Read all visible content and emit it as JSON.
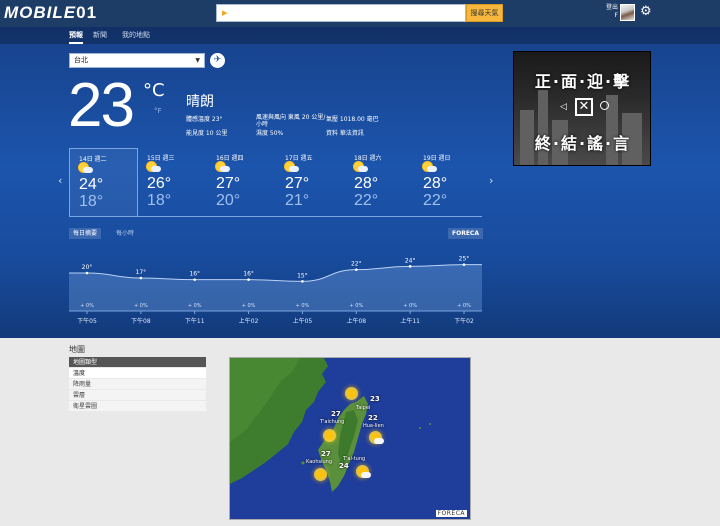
{
  "header": {
    "logo": {
      "a": "MOBILE",
      "b": "01"
    },
    "search": {
      "value": "",
      "button": "搜尋天氣"
    },
    "login": {
      "line1": "登出",
      "line2": "F"
    }
  },
  "nav": {
    "items": [
      "預報",
      "新聞",
      "我的地點"
    ]
  },
  "current": {
    "city": "台北",
    "temp": "23",
    "unit_c": "°C",
    "unit_f": "°F",
    "condition": "晴朗",
    "details": {
      "feels": "體感溫度 23°",
      "visibility": "能見度 10 公里",
      "wind": "風速與風向 東風 20 公里/",
      "wind2": "小時",
      "humidity": "濕度 50%",
      "pressure": "氣壓 1018.00 毫巴",
      "source": "資料 華法資訊"
    }
  },
  "forecast": [
    {
      "day": "14日 週二",
      "hi": "24°",
      "lo": "18°"
    },
    {
      "day": "15日 週三",
      "hi": "26°",
      "lo": "18°"
    },
    {
      "day": "16日 週四",
      "hi": "27°",
      "lo": "20°"
    },
    {
      "day": "17日 週五",
      "hi": "27°",
      "lo": "21°"
    },
    {
      "day": "18日 週六",
      "hi": "28°",
      "lo": "22°"
    },
    {
      "day": "19日 週日",
      "hi": "28°",
      "lo": "22°"
    }
  ],
  "chart_tabs": {
    "daily": "每日摘要",
    "hourly": "每小時",
    "provider": "FORECA"
  },
  "chart_data": {
    "type": "area",
    "categories": [
      "下午05",
      "下午08",
      "下午11",
      "上午02",
      "上午05",
      "上午08",
      "上午11",
      "下午02"
    ],
    "series": [
      {
        "values": [
          20,
          17,
          16,
          16,
          15,
          22,
          24,
          25
        ]
      }
    ],
    "temp_labels": [
      "20°",
      "17°",
      "16°",
      "16°",
      "15°",
      "22°",
      "24°",
      "25°"
    ],
    "precip_labels": [
      "+ 0%",
      "+ 0%",
      "+ 0%",
      "+ 0%",
      "+ 0%",
      "+ 0%",
      "+ 0%",
      "+ 0%"
    ],
    "ylim": [
      0,
      30
    ]
  },
  "ad": {
    "line1": "正·面·迎·擊",
    "line2": "終·結·謠·言"
  },
  "maps": {
    "title": "地圖",
    "list": [
      "地圖類型",
      "溫度",
      "降雨量",
      "雲層",
      "衛星雲圖"
    ],
    "foreca": "FORECA",
    "cities": [
      {
        "name": "Taipei",
        "temp": "23"
      },
      {
        "name": "T'aichung",
        "temp": "27"
      },
      {
        "name": "Hua-lien",
        "temp": "22"
      },
      {
        "name": "Kaohsiung",
        "temp": "27"
      },
      {
        "name": "T'ai-tung",
        "temp": "24"
      }
    ]
  },
  "colors": {
    "topbar": "#1d3c66",
    "main_blue": "#1c55ad",
    "search_button": "#f6b73c",
    "sun": "#ffc20e"
  }
}
